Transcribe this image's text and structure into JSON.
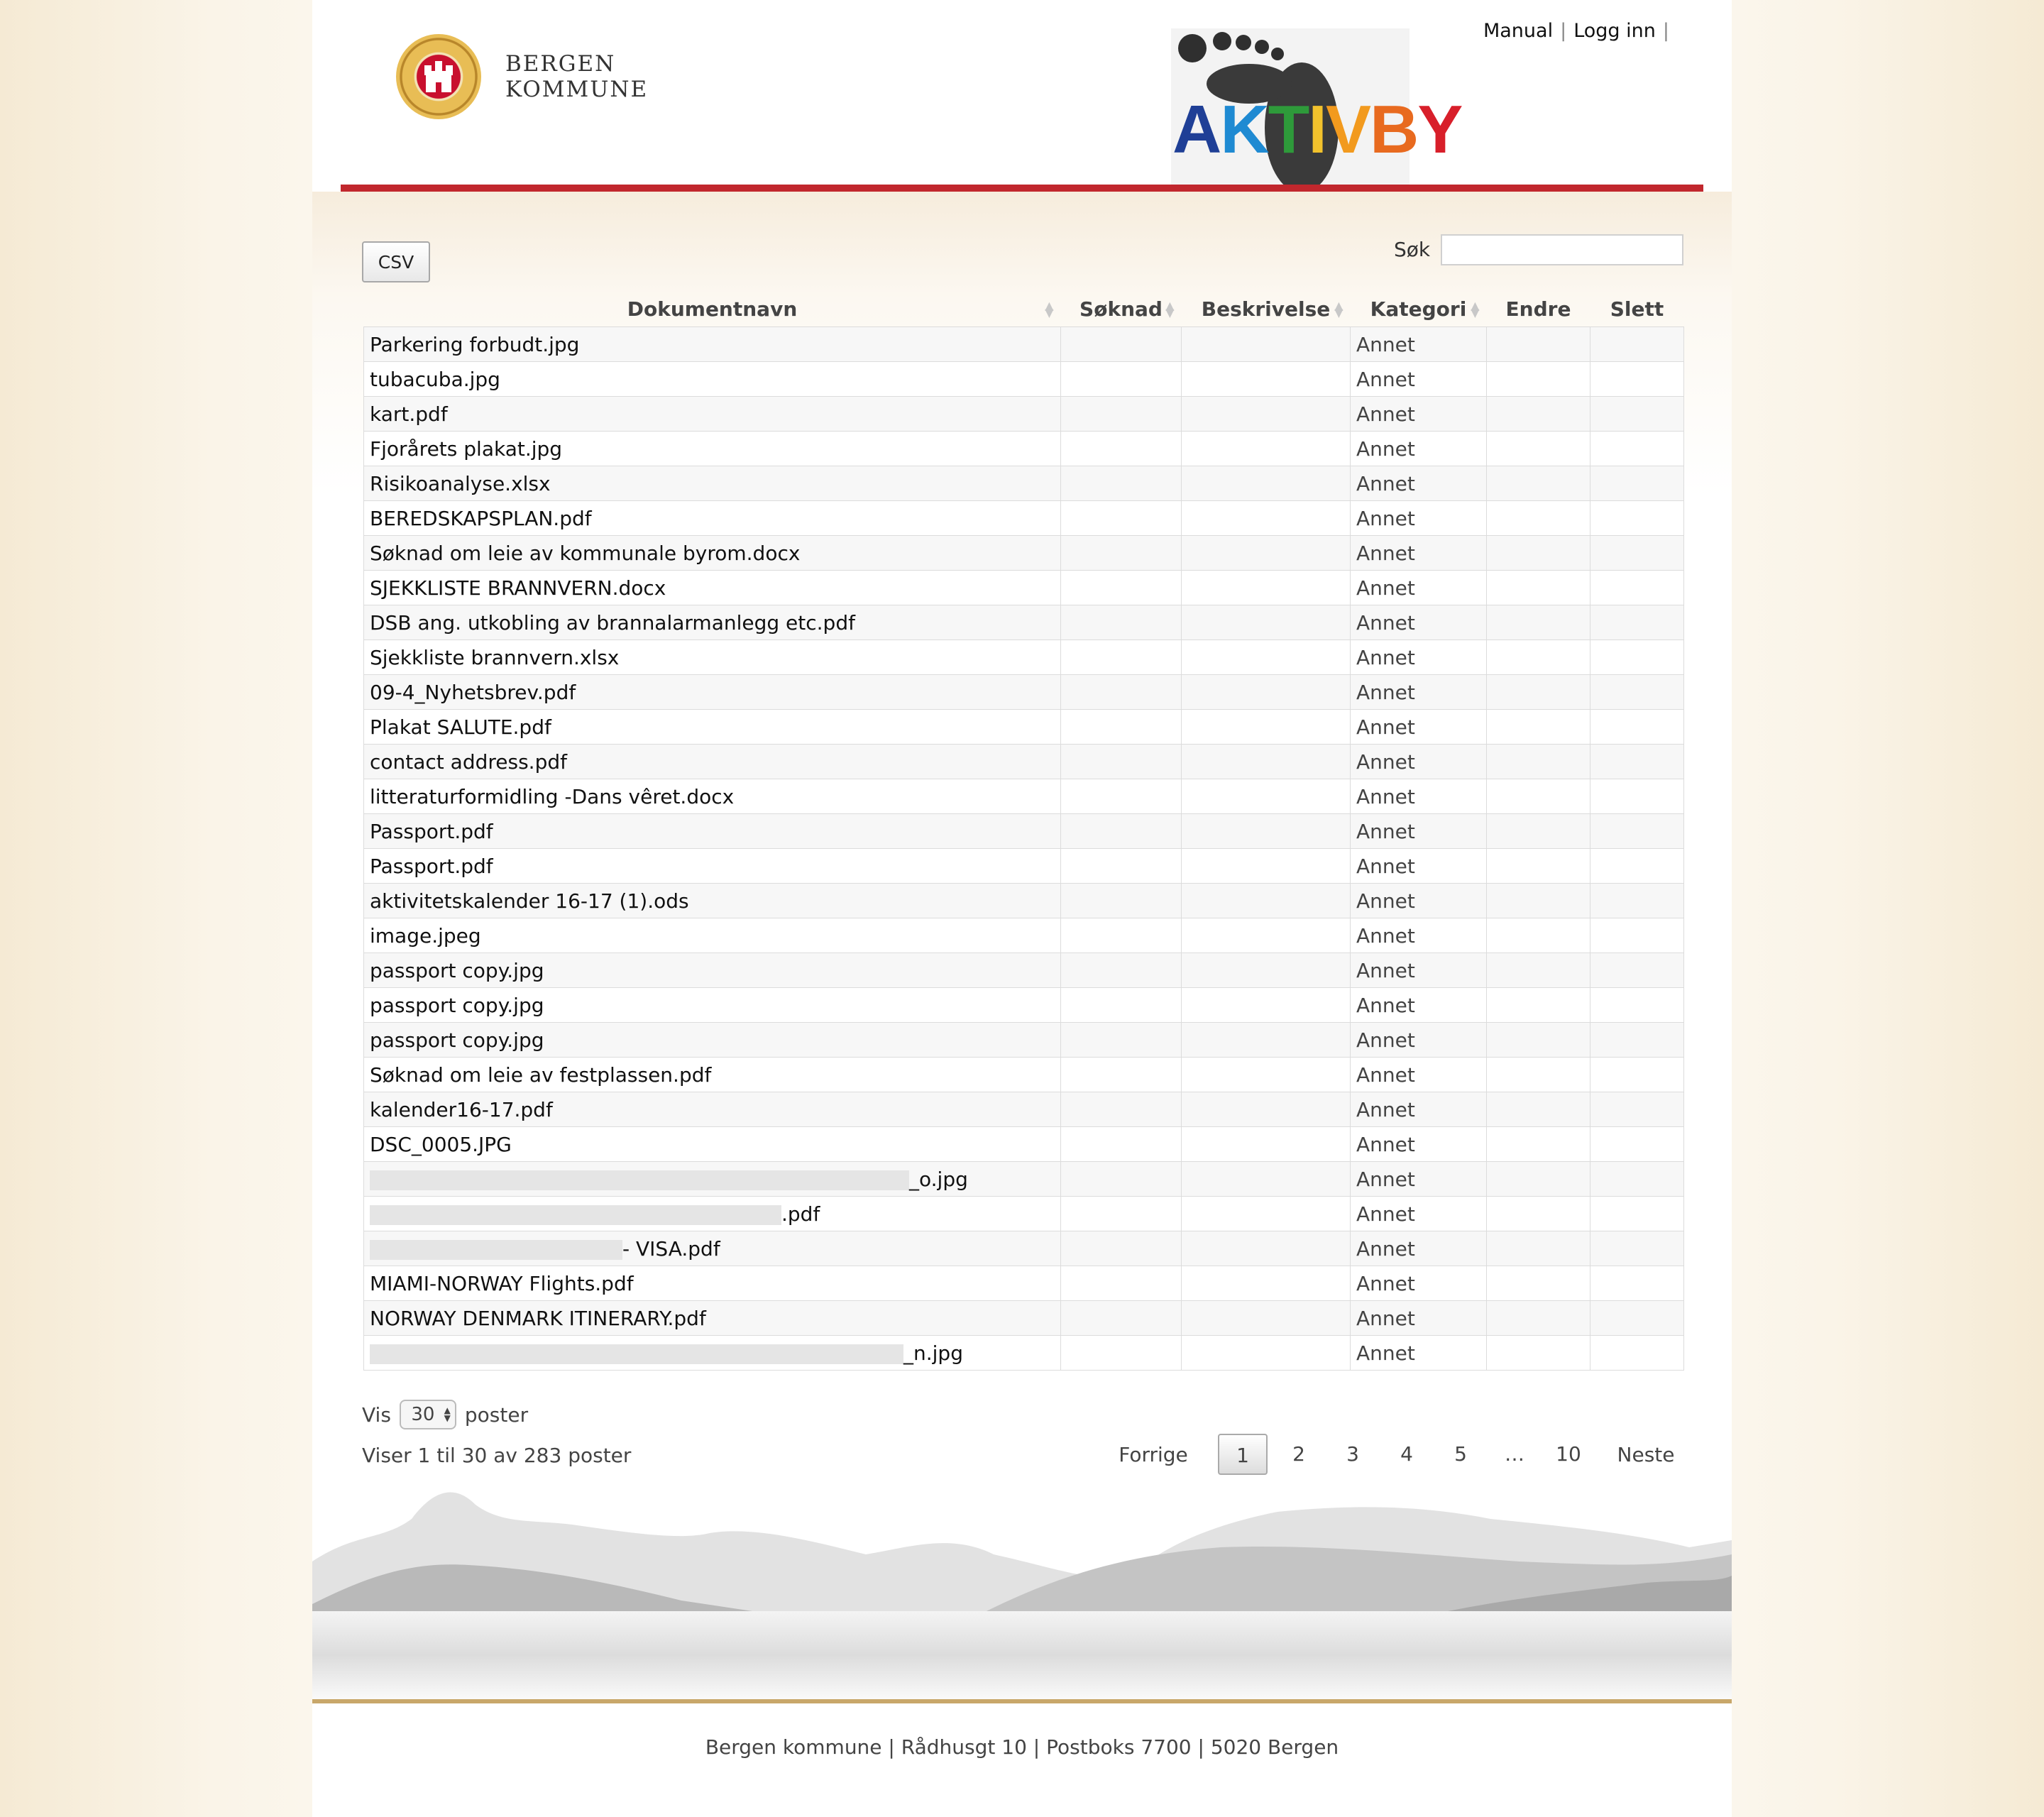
{
  "brand": {
    "org_line1": "BERGEN",
    "org_line2": "KOMMUNE",
    "app_logo": "AKTIVBY",
    "app_logo_letters": [
      "A",
      "K",
      "T",
      "I",
      "V",
      "B",
      "Y"
    ],
    "app_logo_colors": [
      "#1f3f96",
      "#1f8ad2",
      "#2e9a3a",
      "#f2c22c",
      "#f29a1e",
      "#e86a1f",
      "#d81f2a"
    ]
  },
  "nav": {
    "manual": "Manual",
    "login": "Logg inn",
    "separator": "|"
  },
  "toolbar": {
    "csv_label": "CSV",
    "search_label": "Søk",
    "search_value": ""
  },
  "table": {
    "headers": [
      "Dokumentnavn",
      "Søknad",
      "Beskrivelse",
      "Kategori",
      "Endre",
      "Slett"
    ],
    "rows": [
      {
        "name": "Parkering forbudt.jpg",
        "category": "Annet"
      },
      {
        "name": "tubacuba.jpg",
        "category": "Annet"
      },
      {
        "name": "kart.pdf",
        "category": "Annet"
      },
      {
        "name": "Fjorårets plakat.jpg",
        "category": "Annet"
      },
      {
        "name": "Risikoanalyse.xlsx",
        "category": "Annet"
      },
      {
        "name": "BEREDSKAPSPLAN.pdf",
        "category": "Annet"
      },
      {
        "name": "Søknad om leie av kommunale byrom.docx",
        "category": "Annet"
      },
      {
        "name": "SJEKKLISTE BRANNVERN.docx",
        "category": "Annet"
      },
      {
        "name": "DSB ang. utkobling av brannalarmanlegg etc.pdf",
        "category": "Annet"
      },
      {
        "name": "Sjekkliste brannvern.xlsx",
        "category": "Annet"
      },
      {
        "name": "09-4_Nyhetsbrev.pdf",
        "category": "Annet"
      },
      {
        "name": "Plakat SALUTE.pdf",
        "category": "Annet"
      },
      {
        "name": "contact address.pdf",
        "category": "Annet"
      },
      {
        "name": "litteraturformidling -Dans vêret.docx",
        "category": "Annet"
      },
      {
        "name": "Passport.pdf",
        "category": "Annet"
      },
      {
        "name": "Passport.pdf",
        "category": "Annet"
      },
      {
        "name": "aktivitetskalender 16-17 (1).ods",
        "category": "Annet"
      },
      {
        "name": "image.jpeg",
        "category": "Annet"
      },
      {
        "name": "passport copy.jpg",
        "category": "Annet"
      },
      {
        "name": "passport copy.jpg",
        "category": "Annet"
      },
      {
        "name": "passport copy.jpg",
        "category": "Annet"
      },
      {
        "name": "Søknad om leie av festplassen.pdf",
        "category": "Annet"
      },
      {
        "name": "kalender16-17.pdf",
        "category": "Annet"
      },
      {
        "name": "DSC_0005.JPG",
        "category": "Annet"
      },
      {
        "name": "_o.jpg",
        "category": "Annet",
        "redacted": true
      },
      {
        "name": ".pdf",
        "category": "Annet",
        "redacted": true
      },
      {
        "name": "- VISA.pdf",
        "category": "Annet",
        "redacted": true
      },
      {
        "name": "MIAMI-NORWAY Flights.pdf",
        "category": "Annet"
      },
      {
        "name": "NORWAY DENMARK ITINERARY.pdf",
        "category": "Annet"
      },
      {
        "name": "_n.jpg",
        "category": "Annet",
        "redacted": true
      }
    ]
  },
  "length": {
    "prefix": "Vis",
    "value": "30",
    "suffix": "poster"
  },
  "info": "Viser 1 til 30 av 283 poster",
  "pagination": {
    "prev": "Forrige",
    "pages": [
      "1",
      "2",
      "3",
      "4",
      "5",
      "…",
      "10"
    ],
    "current": "1",
    "next": "Neste"
  },
  "footer": "Bergen kommune | Rådhusgt 10 | Postboks 7700 | 5020 Bergen"
}
